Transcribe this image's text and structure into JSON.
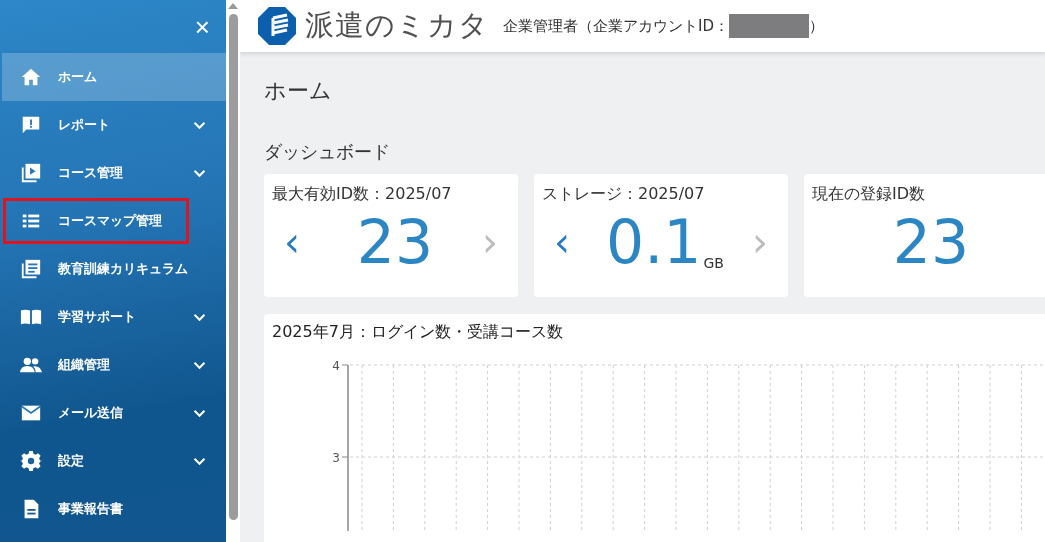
{
  "sidebar": {
    "close": "×",
    "items": [
      {
        "label": "ホーム",
        "selected": true,
        "has_submenu": false,
        "highlighted": false
      },
      {
        "label": "レポート",
        "selected": false,
        "has_submenu": true,
        "highlighted": false
      },
      {
        "label": "コース管理",
        "selected": false,
        "has_submenu": true,
        "highlighted": false
      },
      {
        "label": "コースマップ管理",
        "selected": false,
        "has_submenu": false,
        "highlighted": true
      },
      {
        "label": "教育訓練カリキュラム",
        "selected": false,
        "has_submenu": false,
        "highlighted": false
      },
      {
        "label": "学習サポート",
        "selected": false,
        "has_submenu": true,
        "highlighted": false
      },
      {
        "label": "組織管理",
        "selected": false,
        "has_submenu": true,
        "highlighted": false
      },
      {
        "label": "メール送信",
        "selected": false,
        "has_submenu": true,
        "highlighted": false
      },
      {
        "label": "設定",
        "selected": false,
        "has_submenu": true,
        "highlighted": false
      },
      {
        "label": "事業報告書",
        "selected": false,
        "has_submenu": false,
        "highlighted": false
      }
    ]
  },
  "header": {
    "logo_text": "派遣のミカタ",
    "account_label": "企業管理者（企業アカウントID：",
    "account_id_redacted": true,
    "account_close": "）"
  },
  "page_title": "ホーム",
  "dashboard": {
    "heading": "ダッシュボード",
    "cards": [
      {
        "title": "最大有効ID数：2025/07",
        "value": "23",
        "prev": "‹",
        "next": "›",
        "prev_enabled": true,
        "next_enabled": false
      },
      {
        "title": "ストレージ：2025/07",
        "value": "0.1",
        "unit": "GB",
        "prev": "‹",
        "next": "›",
        "prev_enabled": true,
        "next_enabled": false
      },
      {
        "title": "現在の登録ID数",
        "value": "23"
      }
    ]
  },
  "chart": {
    "title": "2025年7月：ログイン数・受講コース数",
    "y_tick_labels": [
      "4",
      "3"
    ]
  }
}
